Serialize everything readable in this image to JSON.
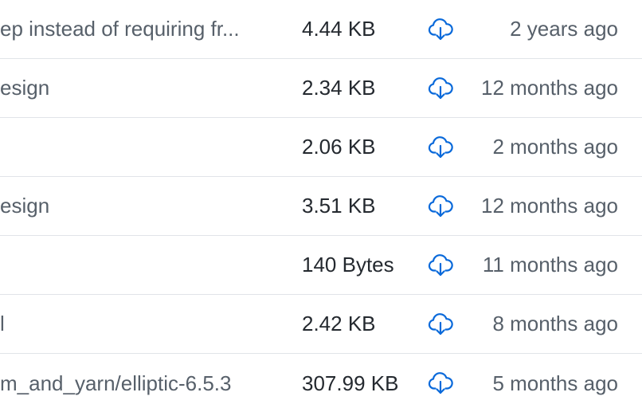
{
  "colors": {
    "download_icon": "#0969da",
    "divider": "#e1e4e8",
    "muted_text": "#57606a",
    "main_text": "#24292f"
  },
  "rows": [
    {
      "name": "ep instead of requiring fr...",
      "size": "4.44 KB",
      "download_icon": "cloud-download-icon",
      "updated": "2 years ago"
    },
    {
      "name": "esign",
      "size": "2.34 KB",
      "download_icon": "cloud-download-icon",
      "updated": "12 months ago"
    },
    {
      "name": "",
      "size": "2.06 KB",
      "download_icon": "cloud-download-icon",
      "updated": "2 months ago"
    },
    {
      "name": "esign",
      "size": "3.51 KB",
      "download_icon": "cloud-download-icon",
      "updated": "12 months ago"
    },
    {
      "name": "",
      "size": "140 Bytes",
      "download_icon": "cloud-download-icon",
      "updated": "11 months ago"
    },
    {
      "name": "l",
      "size": "2.42 KB",
      "download_icon": "cloud-download-icon",
      "updated": "8 months ago"
    },
    {
      "name": "m_and_yarn/elliptic-6.5.3",
      "size": "307.99 KB",
      "download_icon": "cloud-download-icon",
      "updated": "5 months ago"
    }
  ]
}
